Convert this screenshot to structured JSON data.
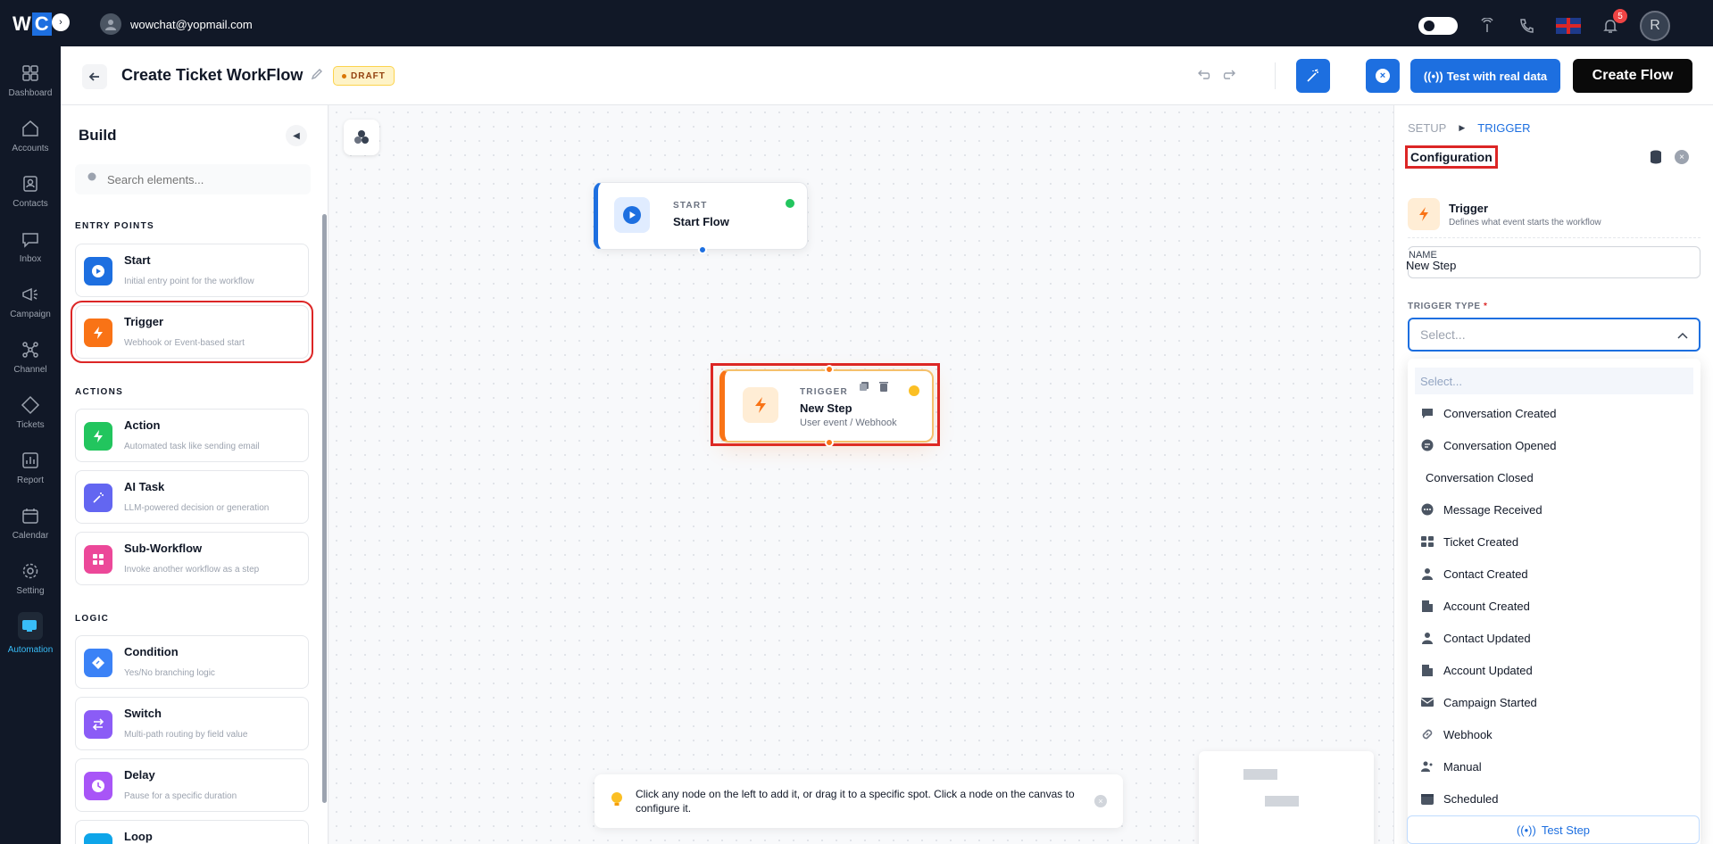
{
  "topbar": {
    "logo_w": "W",
    "logo_c": "C",
    "user_email": "wowchat@yopmail.com",
    "notification_count": "5",
    "avatar_initial": "R"
  },
  "nav": [
    {
      "label": "Dashboard",
      "icon": "dashboard-icon"
    },
    {
      "label": "Accounts",
      "icon": "home-icon"
    },
    {
      "label": "Contacts",
      "icon": "contacts-icon"
    },
    {
      "label": "Inbox",
      "icon": "chat-icon"
    },
    {
      "label": "Campaign",
      "icon": "megaphone-icon"
    },
    {
      "label": "Channel",
      "icon": "channel-icon"
    },
    {
      "label": "Tickets",
      "icon": "ticket-icon"
    },
    {
      "label": "Report",
      "icon": "report-icon"
    },
    {
      "label": "Calendar",
      "icon": "calendar-icon"
    },
    {
      "label": "Setting",
      "icon": "gear-icon"
    },
    {
      "label": "Automation",
      "icon": "automation-icon",
      "active": true
    }
  ],
  "header": {
    "title": "Create Ticket WorkFlow",
    "status": "DRAFT",
    "test_label": "Test with real data",
    "create_label": "Create Flow"
  },
  "build": {
    "title": "Build",
    "search_placeholder": "Search elements...",
    "sections": {
      "entry": "ENTRY POINTS",
      "actions": "ACTIONS",
      "logic": "LOGIC"
    },
    "items": {
      "start": {
        "name": "Start",
        "desc": "Initial entry point for the workflow",
        "color": "#1d6fe0"
      },
      "trigger": {
        "name": "Trigger",
        "desc": "Webhook or Event-based start",
        "color": "#f97316"
      },
      "action": {
        "name": "Action",
        "desc": "Automated task like sending email",
        "color": "#22c55e"
      },
      "ai_task": {
        "name": "AI Task",
        "desc": "LLM-powered decision or generation",
        "color": "#6366f1"
      },
      "sub_workflow": {
        "name": "Sub-Workflow",
        "desc": "Invoke another workflow as a step",
        "color": "#ec4899"
      },
      "condition": {
        "name": "Condition",
        "desc": "Yes/No branching logic",
        "color": "#3b82f6"
      },
      "switch": {
        "name": "Switch",
        "desc": "Multi-path routing by field value",
        "color": "#8b5cf6"
      },
      "delay": {
        "name": "Delay",
        "desc": "Pause for a specific duration",
        "color": "#a855f7"
      },
      "loop": {
        "name": "Loop",
        "desc": "",
        "color": "#0ea5e9"
      }
    }
  },
  "canvas": {
    "start_node": {
      "kind": "START",
      "name": "Start Flow"
    },
    "trigger_node": {
      "kind": "TRIGGER",
      "name": "New Step",
      "sub": "User event / Webhook"
    },
    "hint": "Click any node on the left to add it, or drag it to a specific spot. Click a node on the canvas to configure it."
  },
  "panel": {
    "crumb_setup": "SETUP",
    "crumb_trigger": "TRIGGER",
    "config_title": "Configuration",
    "trigger_heading": "Trigger",
    "trigger_desc": "Defines what event starts the workflow",
    "name_label": "NAME",
    "name_value": "New Step",
    "trigger_type_label": "TRIGGER TYPE",
    "required_mark": "*",
    "select_placeholder": "Select...",
    "options": [
      {
        "label": "Select...",
        "icon": ""
      },
      {
        "label": "Conversation Created",
        "icon": "chat-bubble-icon"
      },
      {
        "label": "Conversation Opened",
        "icon": "chat-open-icon"
      },
      {
        "label": "Conversation Closed",
        "icon": ""
      },
      {
        "label": "Message Received",
        "icon": "message-icon"
      },
      {
        "label": "Ticket Created",
        "icon": "ticket-icon"
      },
      {
        "label": "Contact Created",
        "icon": "person-icon"
      },
      {
        "label": "Account Created",
        "icon": "building-icon"
      },
      {
        "label": "Contact Updated",
        "icon": "person-icon"
      },
      {
        "label": "Account Updated",
        "icon": "building-icon"
      },
      {
        "label": "Campaign Started",
        "icon": "mail-icon"
      },
      {
        "label": "Webhook",
        "icon": "link-icon"
      },
      {
        "label": "Manual",
        "icon": "hand-icon"
      },
      {
        "label": "Scheduled",
        "icon": "calendar-icon"
      }
    ],
    "test_step_label": "Test Step"
  }
}
